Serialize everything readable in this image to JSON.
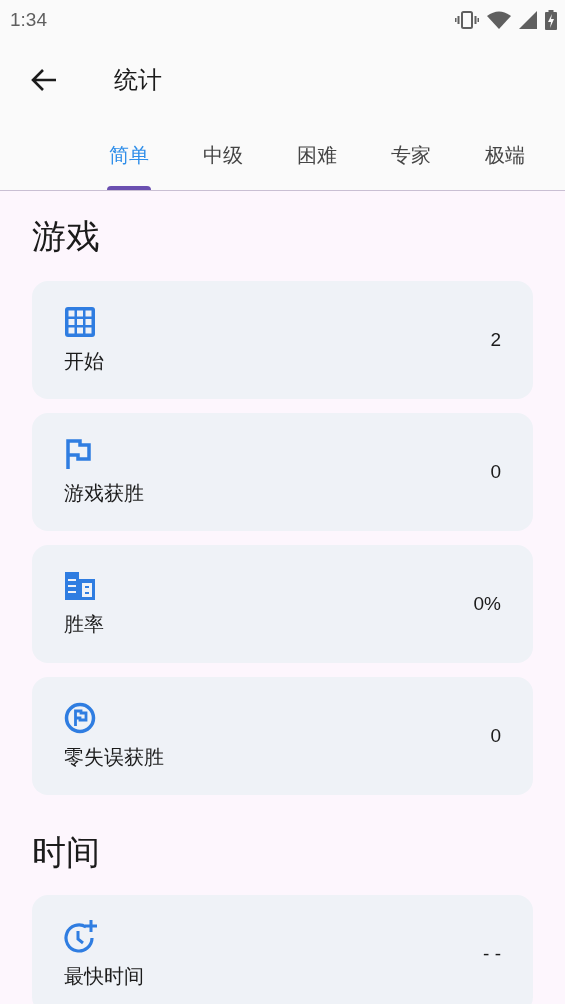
{
  "status_bar": {
    "time": "1:34"
  },
  "app_bar": {
    "title": "统计"
  },
  "tabs": [
    {
      "label": "简单",
      "selected": true
    },
    {
      "label": "中级",
      "selected": false
    },
    {
      "label": "困难",
      "selected": false
    },
    {
      "label": "专家",
      "selected": false
    },
    {
      "label": "极端",
      "selected": false
    }
  ],
  "sections": [
    {
      "title": "游戏",
      "stats": [
        {
          "label": "开始",
          "value": "2"
        },
        {
          "label": "游戏获胜",
          "value": "0"
        },
        {
          "label": "胜率",
          "value": "0%"
        },
        {
          "label": "零失误获胜",
          "value": "0"
        }
      ]
    },
    {
      "title": "时间",
      "stats": [
        {
          "label": "最快时间",
          "value": "- -"
        }
      ]
    }
  ]
}
